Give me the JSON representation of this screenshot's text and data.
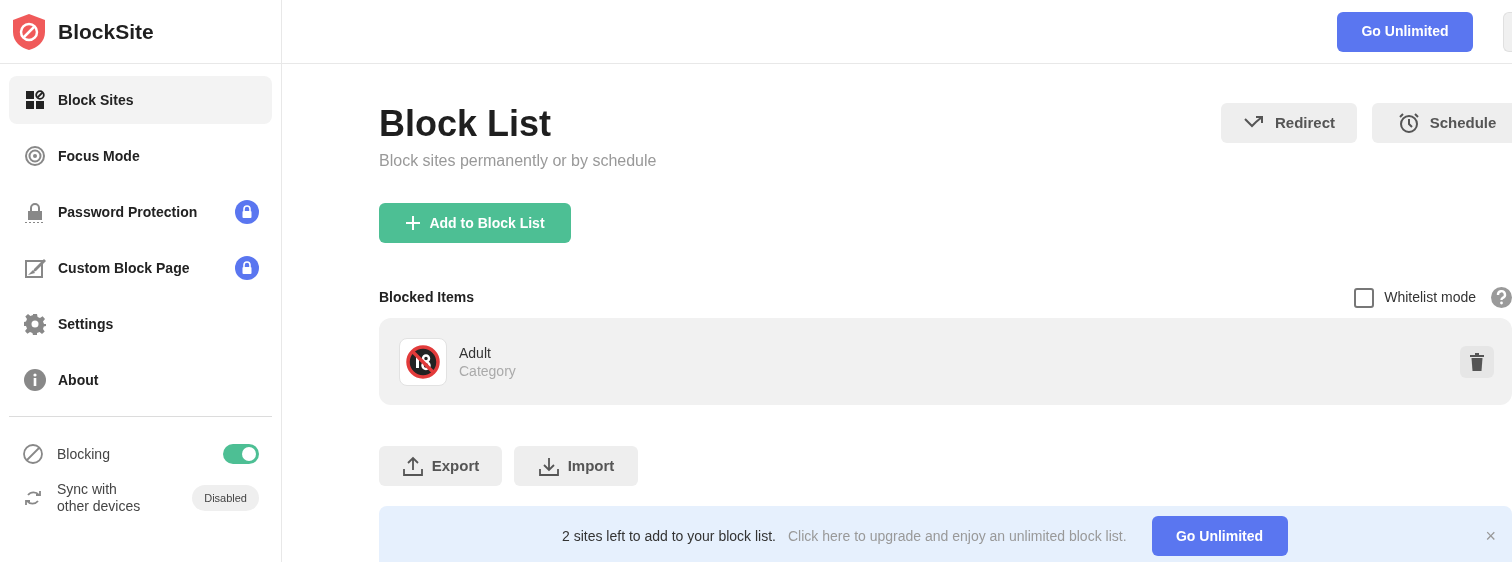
{
  "app": {
    "name": "BlockSite"
  },
  "header": {
    "upgrade_button": "Go Unlimited"
  },
  "sidebar": {
    "items": [
      {
        "label": "Block Sites",
        "selected": true,
        "locked": false
      },
      {
        "label": "Focus Mode",
        "selected": false,
        "locked": false
      },
      {
        "label": "Password Protection",
        "selected": false,
        "locked": true
      },
      {
        "label": "Custom Block Page",
        "selected": false,
        "locked": true
      },
      {
        "label": "Settings",
        "selected": false,
        "locked": false
      },
      {
        "label": "About",
        "selected": false,
        "locked": false
      }
    ],
    "blocking": {
      "label": "Blocking",
      "on": true
    },
    "sync": {
      "label": "Sync with other devices",
      "status": "Disabled"
    }
  },
  "page": {
    "title": "Block List",
    "subtitle": "Block sites permanently or by schedule",
    "actions": [
      {
        "label": "Redirect"
      },
      {
        "label": "Schedule"
      }
    ],
    "add_button": "Add to Block List",
    "blocked_items": {
      "title": "Blocked Items",
      "whitelist": {
        "label": "Whitelist mode",
        "checked": false
      },
      "items": [
        {
          "name": "Adult",
          "type": "Category"
        }
      ]
    },
    "export_button": "Export",
    "import_button": "Import"
  },
  "banner": {
    "message": "2 sites left to add to your block list.",
    "link": "Click here to upgrade and enjoy an unlimited block list.",
    "button": "Go Unlimited",
    "close": "×"
  }
}
